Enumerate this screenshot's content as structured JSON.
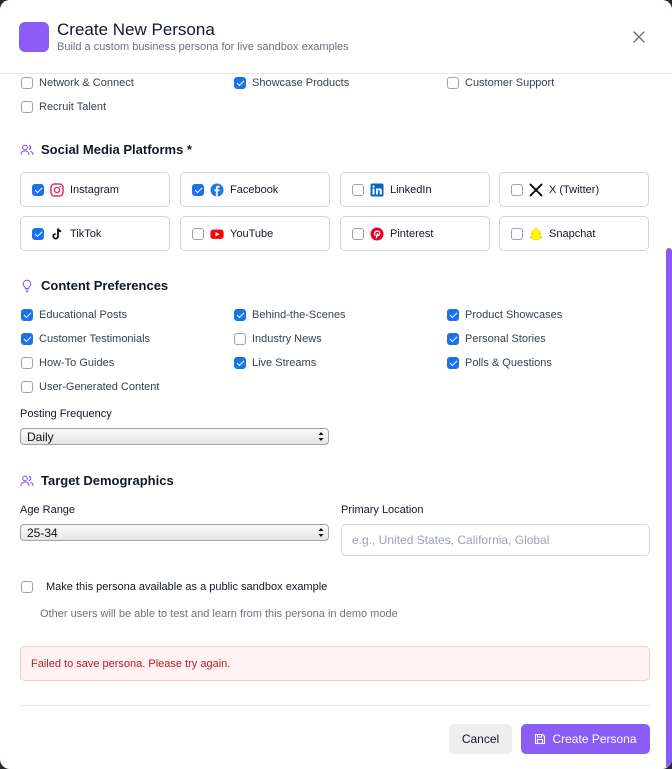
{
  "header": {
    "title": "Create New Persona",
    "subtitle": "Build a custom business persona for live sandbox examples"
  },
  "goals": [
    {
      "label": "Network & Connect",
      "checked": false
    },
    {
      "label": "Showcase Products",
      "checked": true
    },
    {
      "label": "Customer Support",
      "checked": false
    },
    {
      "label": "Recruit Talent",
      "checked": false
    }
  ],
  "social": {
    "title": "Social Media Platforms *",
    "platforms": [
      {
        "label": "Instagram",
        "checked": true,
        "icon": "instagram-icon"
      },
      {
        "label": "Facebook",
        "checked": true,
        "icon": "facebook-icon"
      },
      {
        "label": "LinkedIn",
        "checked": false,
        "icon": "linkedin-icon"
      },
      {
        "label": "X (Twitter)",
        "checked": false,
        "icon": "x-icon"
      },
      {
        "label": "TikTok",
        "checked": true,
        "icon": "tiktok-icon"
      },
      {
        "label": "YouTube",
        "checked": false,
        "icon": "youtube-icon"
      },
      {
        "label": "Pinterest",
        "checked": false,
        "icon": "pinterest-icon"
      },
      {
        "label": "Snapchat",
        "checked": false,
        "icon": "snapchat-icon"
      }
    ]
  },
  "content": {
    "title": "Content Preferences",
    "items": [
      {
        "label": "Educational Posts",
        "checked": true
      },
      {
        "label": "Behind-the-Scenes",
        "checked": true
      },
      {
        "label": "Product Showcases",
        "checked": true
      },
      {
        "label": "Customer Testimonials",
        "checked": true
      },
      {
        "label": "Industry News",
        "checked": false
      },
      {
        "label": "Personal Stories",
        "checked": true
      },
      {
        "label": "How-To Guides",
        "checked": false
      },
      {
        "label": "Live Streams",
        "checked": true
      },
      {
        "label": "Polls & Questions",
        "checked": true
      },
      {
        "label": "User-Generated Content",
        "checked": false
      }
    ],
    "frequency_label": "Posting Frequency",
    "frequency_value": "Daily"
  },
  "demographics": {
    "title": "Target Demographics",
    "age_label": "Age Range",
    "age_value": "25-34",
    "location_label": "Primary Location",
    "location_placeholder": "e.g., United States, California, Global"
  },
  "public": {
    "label": "Make this persona available as a public sandbox example",
    "hint": "Other users will be able to test and learn from this persona in demo mode",
    "checked": false
  },
  "error": "Failed to save persona. Please try again.",
  "buttons": {
    "cancel": "Cancel",
    "create": "Create Persona"
  },
  "colors": {
    "accent": "#8b5cf6",
    "checkbox": "#1a73e8",
    "error_text": "#b91c1c",
    "error_bg": "#fef2f2"
  }
}
